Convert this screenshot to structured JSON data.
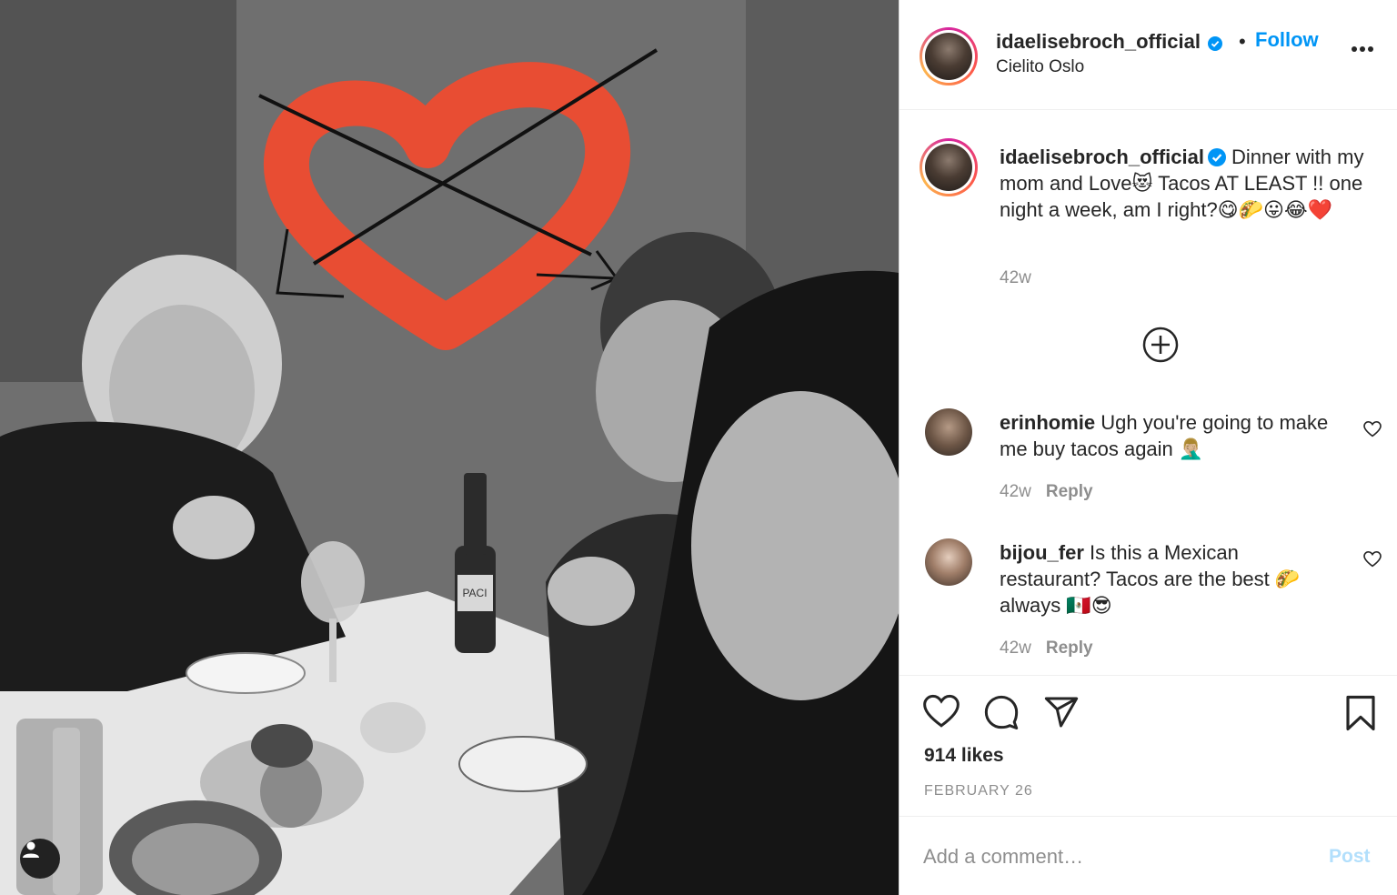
{
  "post": {
    "photo": {
      "bottle_label": "PACI",
      "tag_icon": "person-icon"
    },
    "author": {
      "username": "idaelisebroch_official",
      "location": "Cielito Oslo",
      "follow_label": "Follow",
      "separator": "•",
      "verified": true
    },
    "caption": {
      "username": "idaelisebroch_official",
      "text": "Dinner with my mom and Love😻 Tacos AT LEAST !! one night a week, am I right?😋🌮😛😂❤️",
      "time": "42w"
    },
    "comments": [
      {
        "username": "erinhomie",
        "text": "Ugh you're going to make me buy tacos again 🤦🏼‍♂️",
        "time": "42w",
        "reply_label": "Reply"
      },
      {
        "username": "bijou_fer",
        "text": "Is this a Mexican restaurant? Tacos are the best 🌮 always 🇲🇽😎",
        "time": "42w",
        "reply_label": "Reply"
      }
    ],
    "likes": "914 likes",
    "date": "FEBRUARY 26",
    "comment_input": {
      "placeholder": "Add a comment…"
    },
    "post_label": "Post",
    "colors": {
      "accent": "#0095f6",
      "heart_drawing": "#f24a2e",
      "muted": "#8e8e8e",
      "post_disabled": "#b2dffc"
    }
  }
}
